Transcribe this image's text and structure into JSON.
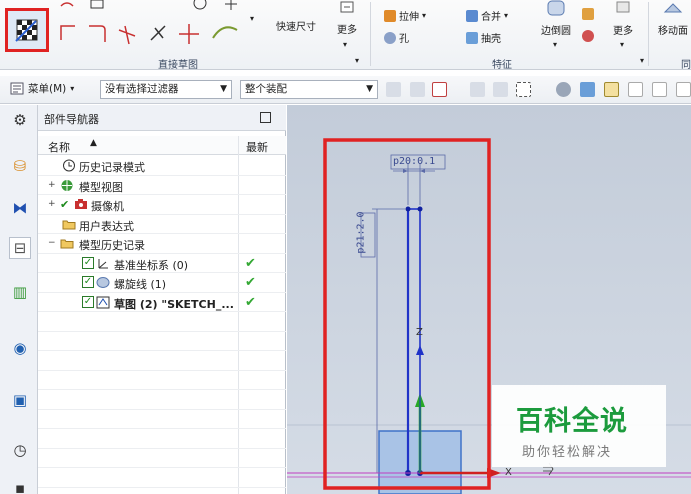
{
  "ribbon": {
    "quick_dim_label": "快速尺寸",
    "more_label_1": "更多",
    "group_direct_sketch": "直接草图",
    "extrude_label": "拉伸",
    "hole_label": "孔",
    "unite_label": "合并",
    "shell_label": "抽壳",
    "edge_blend_label": "边倒圆",
    "more_label_2": "更多",
    "group_feature": "特征",
    "move_face_label": "移动面",
    "group_sync_partial": "同"
  },
  "toolbar": {
    "menu_label": "菜单(M)",
    "filter_select": "没有选择过滤器",
    "assembly_select": "整个装配"
  },
  "navigator": {
    "title": "部件导航器",
    "col_name": "名称",
    "col_latest": "最新",
    "rows": [
      {
        "label": "历史记录模式"
      },
      {
        "label": "模型视图"
      },
      {
        "label": "摄像机"
      },
      {
        "label": "用户表达式"
      },
      {
        "label": "模型历史记录"
      },
      {
        "label": "基准坐标系 (0)"
      },
      {
        "label": "螺旋线 (1)"
      },
      {
        "label": "草图 (2) \"SKETCH_..."
      }
    ]
  },
  "canvas": {
    "dim_top": "p20:0.1",
    "dim_side": "p21:2.0",
    "axis_x": "X",
    "axis_z": "Z"
  },
  "watermark": {
    "title": "百科全说",
    "subtitle": "助你轻松解决"
  },
  "colors": {
    "highlight_red": "#e02222",
    "sketch_blue": "#2033c8",
    "check_green": "#33a833",
    "brand_green": "#1c9b3d"
  }
}
